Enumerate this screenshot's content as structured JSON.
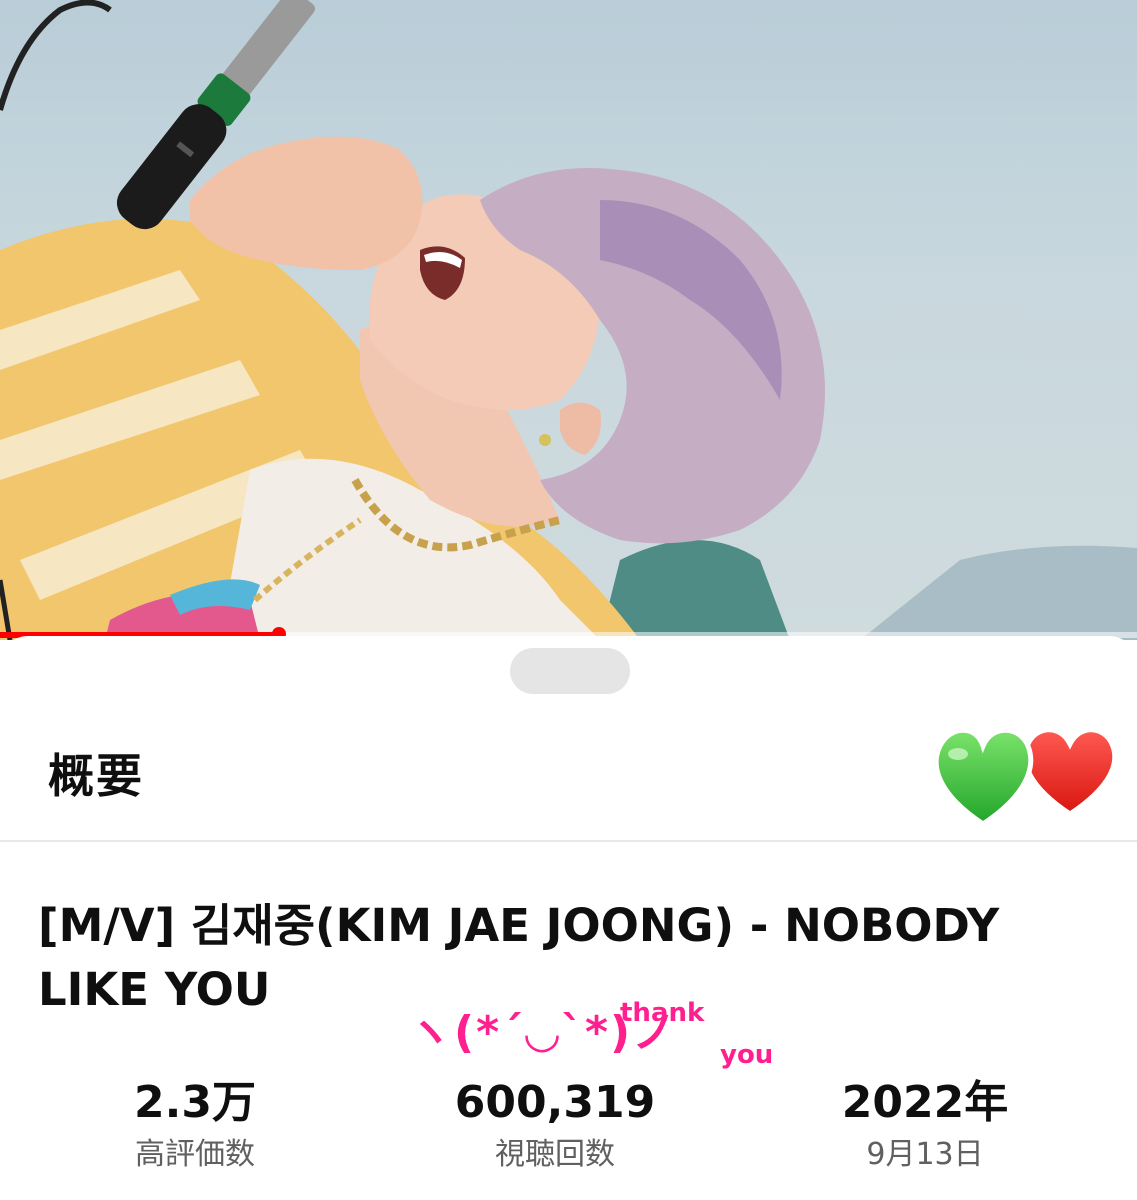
{
  "video": {
    "progress_fraction": 0.245
  },
  "sheet": {
    "title": "概要",
    "sticker": "green-heart-and-red-heart-icon"
  },
  "description": {
    "video_title": "[M/V] 김재중(KIM JAE JOONG) - NOBODY LIKE YOU"
  },
  "stats": {
    "likes_value": "2.3万",
    "likes_label": "高評価数",
    "views_value": "600,319",
    "views_label": "視聴回数",
    "year_value": "2022年",
    "date_label": "9月13日"
  },
  "overlay": {
    "kaomoji": "ヽ(*´◡`*)ノ",
    "thank": "thank",
    "you": "you"
  },
  "colors": {
    "accent_red": "#ff0000",
    "overlay_pink": "#ff1f8e",
    "heart_green": "#3cc43c",
    "heart_red": "#e8221e"
  }
}
